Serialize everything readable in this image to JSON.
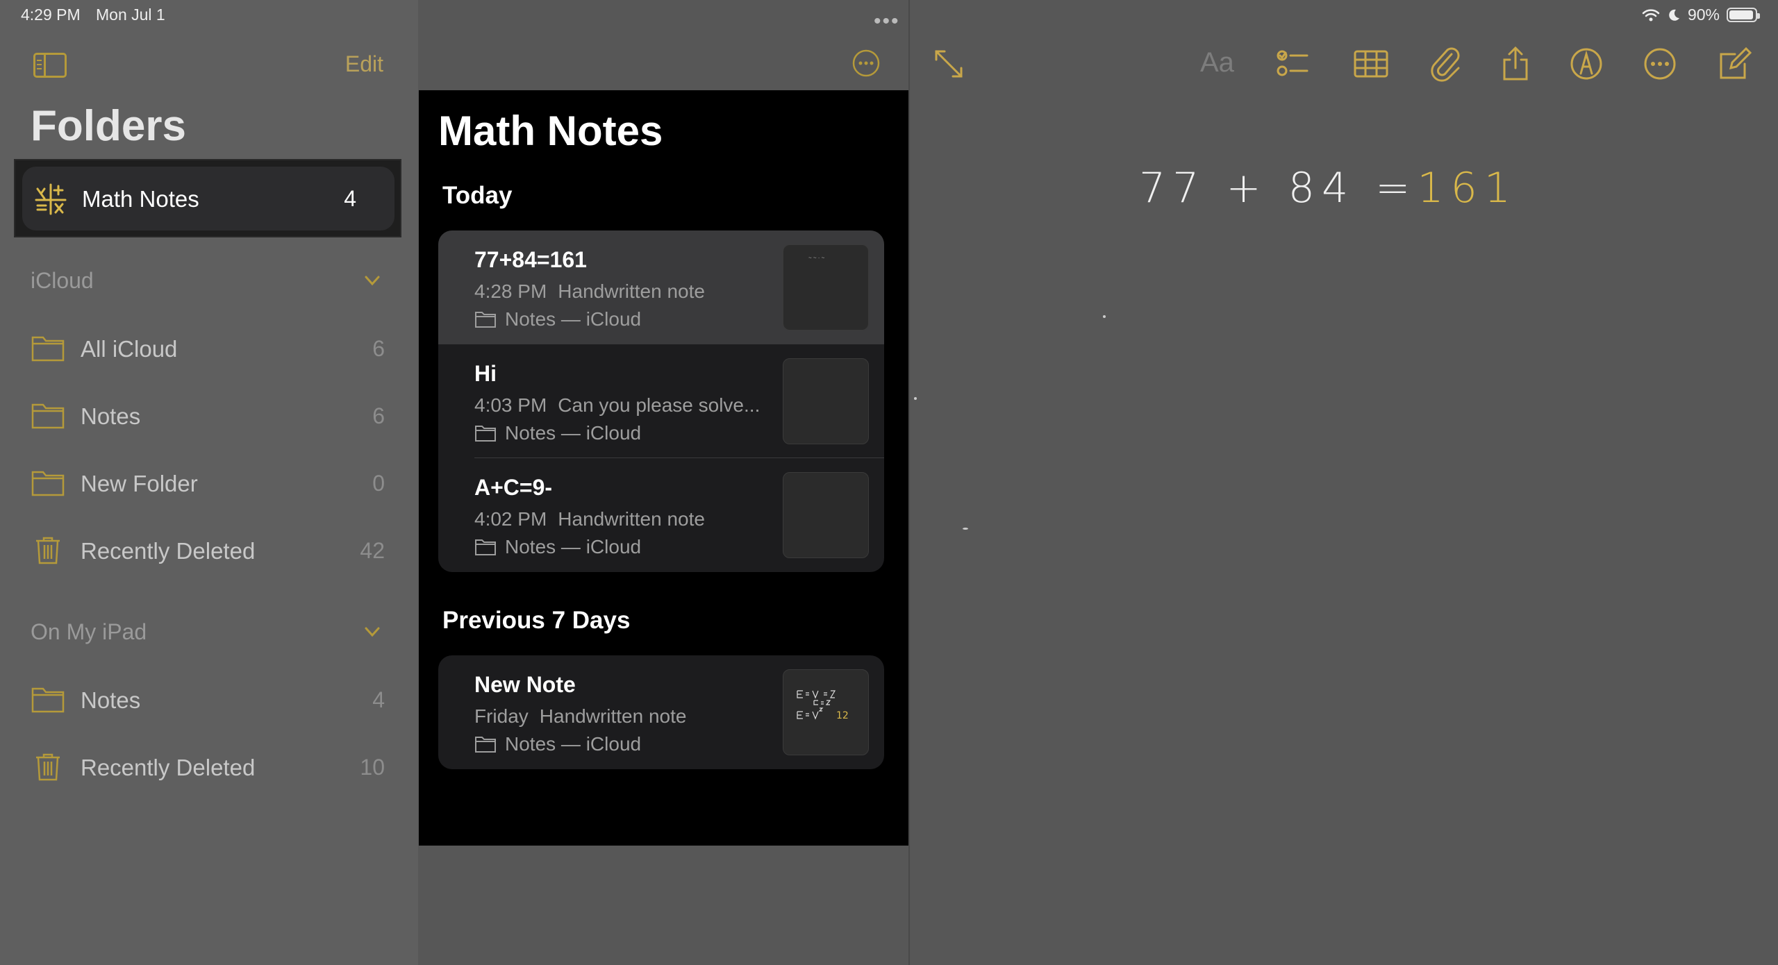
{
  "status": {
    "time": "4:29 PM",
    "date": "Mon Jul 1",
    "battery": "90%"
  },
  "sidebar": {
    "edit_label": "Edit",
    "title": "Folders",
    "selected": {
      "label": "Math Notes",
      "count": "4"
    },
    "icloud": {
      "label": "iCloud",
      "items": [
        {
          "label": "All iCloud",
          "count": "6",
          "icon": "folder-icon"
        },
        {
          "label": "Notes",
          "count": "6",
          "icon": "folder-icon"
        },
        {
          "label": "New Folder",
          "count": "0",
          "icon": "folder-icon"
        },
        {
          "label": "Recently Deleted",
          "count": "42",
          "icon": "trash-icon"
        }
      ]
    },
    "ipad": {
      "label": "On My iPad",
      "items": [
        {
          "label": "Notes",
          "count": "4",
          "icon": "folder-icon"
        },
        {
          "label": "Recently Deleted",
          "count": "10",
          "icon": "trash-icon"
        }
      ]
    }
  },
  "list": {
    "title": "Math Notes",
    "groups": [
      {
        "label": "Today",
        "notes": [
          {
            "title": "77+84=161",
            "time": "4:28 PM",
            "preview": "Handwritten note",
            "folder": "Notes — iCloud"
          },
          {
            "title": "Hi",
            "time": "4:03 PM",
            "preview": "Can you please solve...",
            "folder": "Notes — iCloud"
          },
          {
            "title": "A+C=9-",
            "time": "4:02 PM",
            "preview": "Handwritten note",
            "folder": "Notes — iCloud"
          }
        ]
      },
      {
        "label": "Previous 7 Days",
        "notes": [
          {
            "title": "New Note",
            "time": "Friday",
            "preview": "Handwritten note",
            "folder": "Notes — iCloud"
          }
        ]
      }
    ]
  },
  "editor": {
    "format_label": "Aa",
    "expression": "77 + 84 =",
    "result": "161"
  },
  "colors": {
    "accent": "#d9b84a",
    "background": "#575757",
    "list_bg": "#000000"
  }
}
